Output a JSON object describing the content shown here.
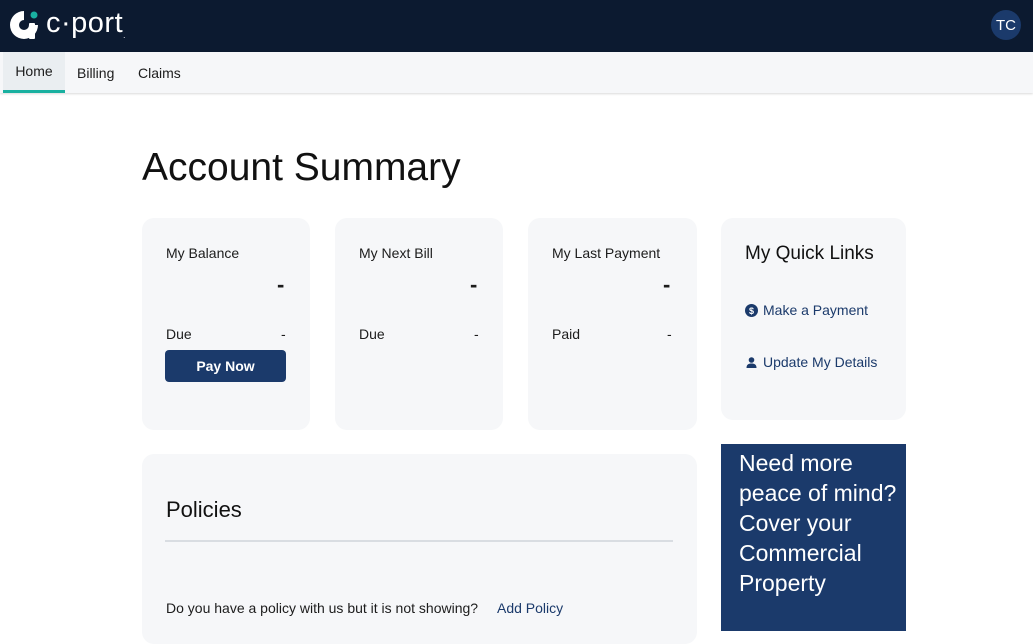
{
  "header": {
    "logo_text": "c·port",
    "logo_tm": ".",
    "avatar_initials": "TC"
  },
  "nav": {
    "tabs": [
      {
        "label": "Home",
        "active": true
      },
      {
        "label": "Billing",
        "active": false
      },
      {
        "label": "Claims",
        "active": false
      }
    ]
  },
  "main": {
    "title": "Account Summary",
    "cards": {
      "balance": {
        "label": "My Balance",
        "amount": "-",
        "row_label": "Due",
        "row_value": "-",
        "button": "Pay Now"
      },
      "next_bill": {
        "label": "My Next Bill",
        "amount": "-",
        "row_label": "Due",
        "row_value": "-"
      },
      "last_payment": {
        "label": "My Last Payment",
        "amount": "-",
        "row_label": "Paid",
        "row_value": "-"
      }
    },
    "quick_links": {
      "title": "My Quick Links",
      "items": [
        {
          "label": "Make a Payment",
          "icon": "dollar-circle-icon"
        },
        {
          "label": "Update My Details",
          "icon": "person-icon"
        }
      ]
    },
    "promo": {
      "text": "Need more peace of mind? Cover your Commercial Property"
    },
    "policies": {
      "title": "Policies",
      "question": "Do you have a policy with us but it is not showing?",
      "add_link": "Add Policy"
    }
  },
  "colors": {
    "header_bg": "#0c1a30",
    "accent_teal": "#19b0a0",
    "primary_navy": "#1b3a6b",
    "card_bg": "#f6f7f9"
  }
}
